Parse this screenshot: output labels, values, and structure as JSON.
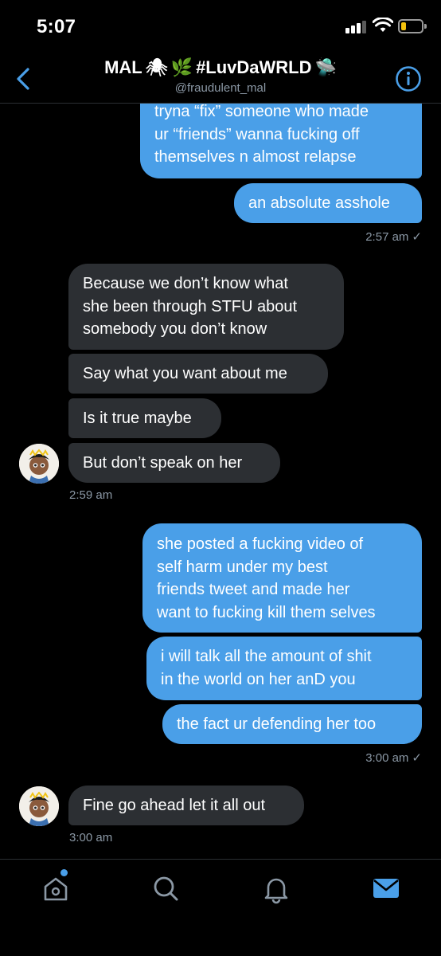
{
  "status_bar": {
    "time": "5:07"
  },
  "header": {
    "title_prefix": "MAL",
    "title_emoji_1": "🕷",
    "title_emoji_2": "🌿",
    "title_suffix": "#LuvDaWRLD",
    "title_emoji_3": "🛸",
    "handle": "@fraudulent_mal"
  },
  "messages": {
    "sent_1": [
      "tryna “fix” someone who made",
      "ur “friends” wanna fucking off",
      "themselves n almost relapse"
    ],
    "sent_2": "an absolute asshole",
    "sent_ts_1": "2:57 am",
    "recv_1": [
      "Because we don’t know what",
      "she been through STFU about",
      "somebody you don’t know"
    ],
    "recv_2": "Say what you want about me",
    "recv_3": "Is it true maybe",
    "recv_4": "But don’t speak on her",
    "recv_ts_1": "2:59 am",
    "sent_3": [
      "she posted a fucking video of",
      "self harm under my best",
      "friends tweet and made her",
      "want to fucking kill them selves"
    ],
    "sent_4": [
      "i will talk all the amount of shit",
      "in the world on her anD you"
    ],
    "sent_5": "the fact ur defending her too",
    "sent_ts_2": "3:00 am",
    "recv_5": "Fine go ahead let it all out",
    "recv_ts_2": "3:00 am"
  },
  "tabbar": {
    "tabs": [
      "home-icon",
      "search-icon",
      "notifications-icon",
      "messages-icon"
    ],
    "active": "messages-icon",
    "accent": "#4a9fe8"
  },
  "colors": {
    "sent_bubble": "#4a9fe8",
    "received_bubble": "#2c2f33",
    "background": "#000000"
  }
}
